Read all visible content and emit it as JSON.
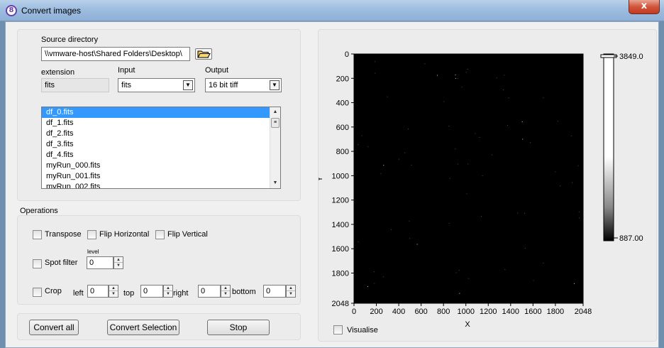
{
  "window": {
    "title": "Convert images",
    "close_glyph": "x"
  },
  "source": {
    "label": "Source directory",
    "path": "\\\\vmware-host\\Shared Folders\\Desktop\\"
  },
  "extension": {
    "label": "extension",
    "value": "fits"
  },
  "input": {
    "label": "Input",
    "value": "fits"
  },
  "output": {
    "label": "Output",
    "value": "16 bit tiff"
  },
  "file_list": {
    "items": [
      "df_0.fits",
      "df_1.fits",
      "df_2.fits",
      "df_3.fits",
      "df_4.fits",
      "myRun_000.fits",
      "myRun_001.fits",
      "myRun_002.fits"
    ],
    "selected_index": 0
  },
  "operations": {
    "label": "Operations",
    "transpose": "Transpose",
    "flip_horizontal": "Flip Horizontal",
    "flip_vertical": "Flip Vertical",
    "spot_filter": "Spot filter",
    "level_label": "level",
    "level_value": "0",
    "crop": "Crop",
    "crop_left_label": "left",
    "crop_left": "0",
    "crop_top_label": "top",
    "crop_top": "0",
    "crop_right_label": "right",
    "crop_right": "0",
    "crop_bottom_label": "bottom",
    "crop_bottom": "0"
  },
  "buttons": {
    "convert_all": "Convert all",
    "convert_selection": "Convert Selection",
    "stop": "Stop"
  },
  "visualise": {
    "label": "Visualise",
    "checked": false
  },
  "image_graph": {
    "x_label": "X",
    "y_label": "Y",
    "x_ticks": [
      "0",
      "200",
      "400",
      "600",
      "800",
      "1000",
      "1200",
      "1400",
      "1600",
      "1800",
      "2048"
    ],
    "y_ticks": [
      "0",
      "200",
      "400",
      "600",
      "800",
      "1000",
      "1200",
      "1400",
      "1600",
      "1800",
      "2048"
    ],
    "colorbar_max": "3849.0",
    "colorbar_min": "887.00",
    "image_color": "#000000"
  }
}
